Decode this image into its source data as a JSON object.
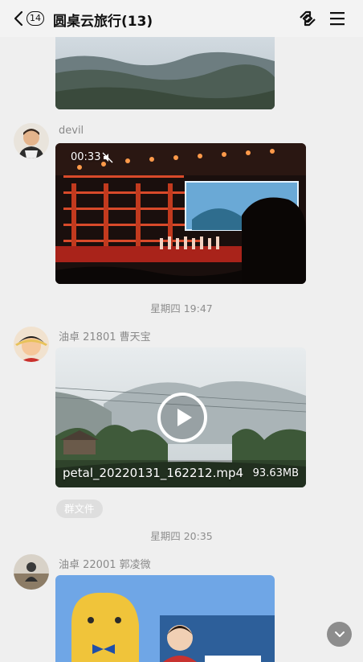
{
  "header": {
    "unread_count": "14",
    "title": "圆桌云旅行(13)",
    "link_icon": "link-icon",
    "menu_icon": "hamburger-menu-icon"
  },
  "messages": [
    {
      "sender": "devil",
      "video": {
        "duration": "00:33",
        "muted_icon": "mute-icon"
      }
    },
    {
      "timestamp": "星期四 19:47"
    },
    {
      "sender": "油卓 21801 曹天宝",
      "file": {
        "name": "petal_20220131_162212.mp4",
        "size": "93.63MB",
        "tag": "群文件",
        "play_icon": "play-icon"
      }
    },
    {
      "timestamp": "星期四 20:35"
    },
    {
      "sender": "油卓 22001 郭凌微"
    }
  ],
  "scroll_button_icon": "chevron-down-icon"
}
